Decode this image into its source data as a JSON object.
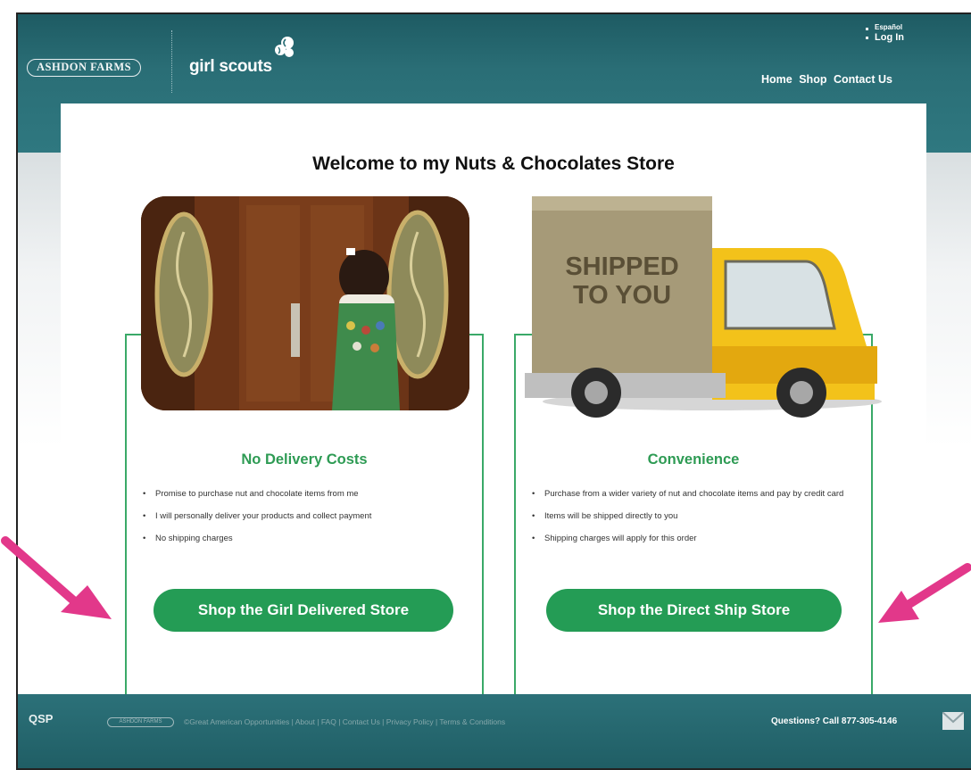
{
  "header": {
    "brand_ashdon": "ASHDON FARMS",
    "brand_gs": "girl scouts",
    "top_links": {
      "espanol": "Español",
      "login": "Log In"
    },
    "nav": [
      "Home",
      "Shop",
      "Contact Us"
    ]
  },
  "main": {
    "welcome": "Welcome to my Nuts & Chocolates Store",
    "cards": [
      {
        "title": "No Delivery Costs",
        "bullets": [
          "Promise to purchase nut and chocolate items from me",
          "I will personally deliver your products and collect payment",
          "No shipping charges"
        ],
        "button": "Shop the Girl Delivered Store"
      },
      {
        "title": "Convenience",
        "bullets": [
          "Purchase from a wider variety of nut and chocolate items and pay by credit card",
          "Items will be shipped directly to you",
          "Shipping charges will apply for this order"
        ],
        "button": "Shop the Direct Ship Store"
      }
    ],
    "truck_box_text": [
      "SHIPPED",
      "TO YOU"
    ]
  },
  "footer": {
    "qsp": "QSP",
    "ashdon": "ASHDON FARMS",
    "links": "©Great American Opportunities | About | FAQ | Contact Us | Privacy Policy | Terms & Conditions",
    "call": "Questions? Call 877-305-4146"
  },
  "colors": {
    "header_teal": "#2a6e76",
    "accent_green": "#249c55",
    "title_green": "#2e9b54",
    "annotation_arrow": "#e2388a"
  }
}
